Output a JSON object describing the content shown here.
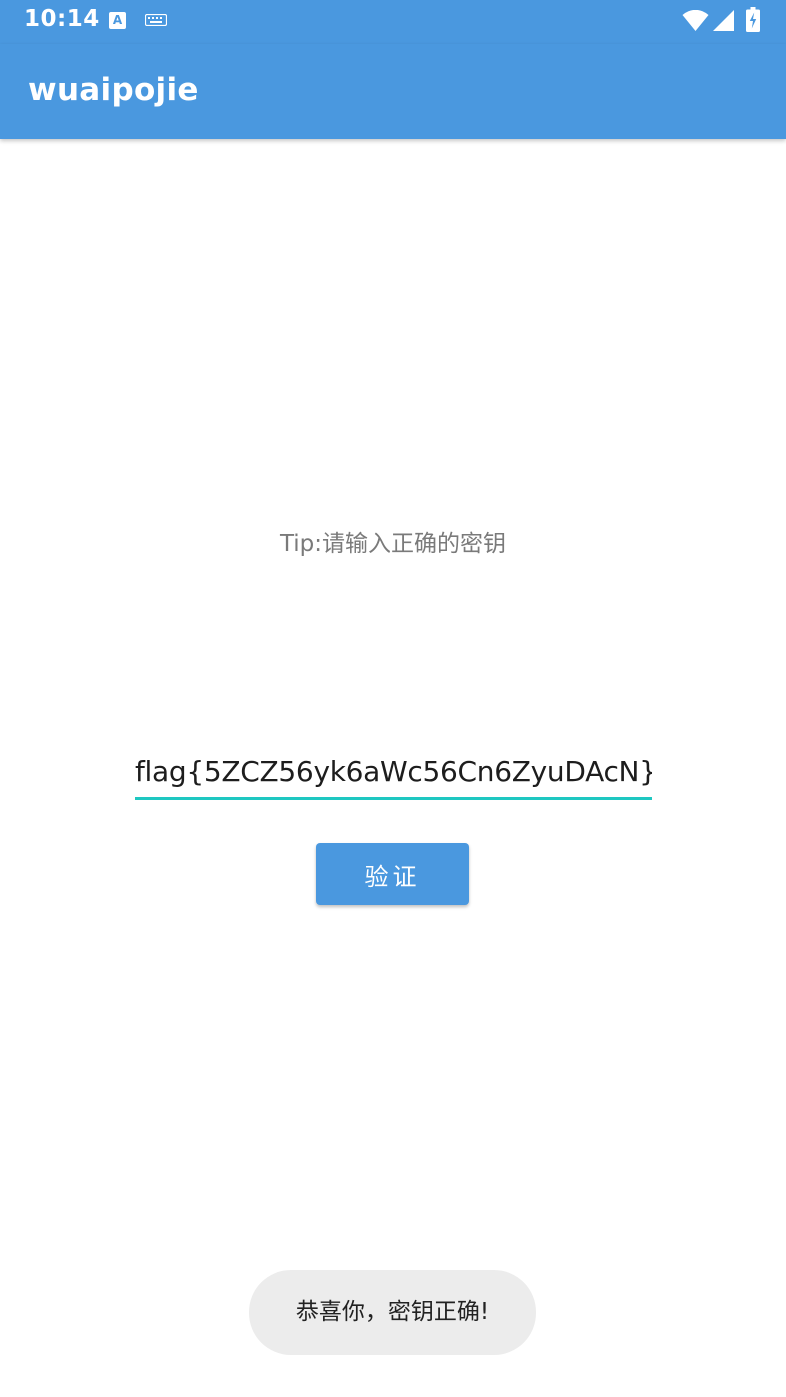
{
  "status_bar": {
    "time": "10:14",
    "notification_icons": [
      "accessibility-a-icon",
      "keyboard-icon"
    ],
    "system_icons": [
      "wifi-icon",
      "cell-signal-icon",
      "battery-charging-icon"
    ]
  },
  "app_bar": {
    "title": "wuaipojie"
  },
  "main": {
    "tip": "Tip:请输入正确的密钥",
    "key_input_value": "flag{5ZCZ56yk6aWc56Cn6ZyuDAcN}",
    "verify_button_label": "验证"
  },
  "toast": {
    "message": "恭喜你，密钥正确!"
  },
  "colors": {
    "primary": "#4a98df",
    "input_underline": "#1ec7c1",
    "toast_background": "#ececec"
  }
}
